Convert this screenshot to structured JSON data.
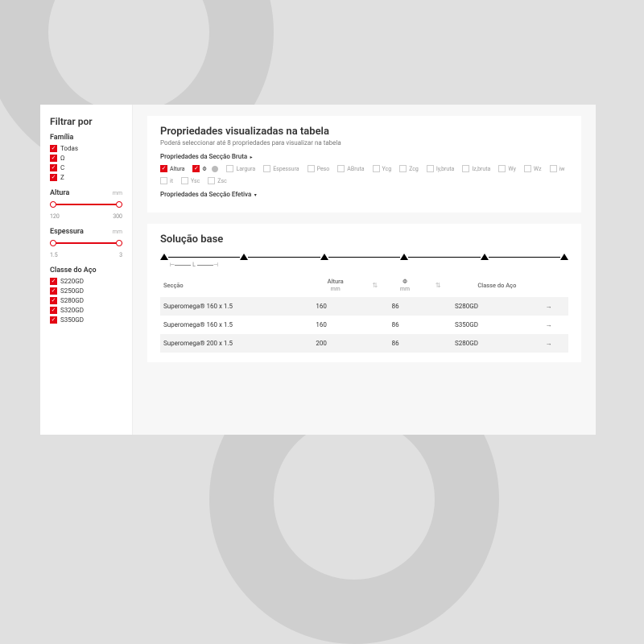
{
  "sidebar": {
    "title": "Filtrar por",
    "familia": {
      "title": "Família",
      "items": [
        {
          "label": "Todas",
          "checked": true
        },
        {
          "label": "Ω",
          "checked": true
        },
        {
          "label": "C",
          "checked": true
        },
        {
          "label": "Z",
          "checked": true
        }
      ]
    },
    "altura": {
      "title": "Altura",
      "unit": "mm",
      "min": "120",
      "max": "300"
    },
    "espessura": {
      "title": "Espessura",
      "unit": "mm",
      "min": "1.5",
      "max": "3"
    },
    "classe": {
      "title": "Classe do Aço",
      "items": [
        {
          "label": "S220GD",
          "checked": true
        },
        {
          "label": "S250GD",
          "checked": true
        },
        {
          "label": "S280GD",
          "checked": true
        },
        {
          "label": "S320GD",
          "checked": true
        },
        {
          "label": "S350GD",
          "checked": true
        }
      ]
    }
  },
  "propsCard": {
    "title": "Propriedades visualizadas na tabela",
    "subtitle": "Poderá seleccionar até 8 propriedades para visualizar na tabela",
    "sectBruta": "Propriedades da Secção Bruta",
    "sectEfetiva": "Propriedades da Secção Efetiva",
    "props": [
      {
        "label": "Altura",
        "checked": true
      },
      {
        "label": "Φ",
        "checked": true
      },
      {
        "label": "Largura",
        "checked": false
      },
      {
        "label": "Espessura",
        "checked": false
      },
      {
        "label": "Peso",
        "checked": false
      },
      {
        "label": "ABruta",
        "checked": false
      },
      {
        "label": "Ycg",
        "checked": false
      },
      {
        "label": "Zcg",
        "checked": false
      },
      {
        "label": "Iy,bruta",
        "checked": false
      },
      {
        "label": "Iz,bruta",
        "checked": false
      },
      {
        "label": "Wy",
        "checked": false
      },
      {
        "label": "Wz",
        "checked": false
      },
      {
        "label": "iw",
        "checked": false
      },
      {
        "label": "it",
        "checked": false
      },
      {
        "label": "Ysc",
        "checked": false
      },
      {
        "label": "Zsc",
        "checked": false
      }
    ]
  },
  "solutionCard": {
    "title": "Solução base",
    "lengthLabel": "L",
    "columns": {
      "seccao": "Secção",
      "altura": "Altura",
      "altura_unit": "mm",
      "phi": "Φ",
      "phi_unit": "mm",
      "classe": "Classe do Aço"
    },
    "rows": [
      {
        "seccao": "Superomega® 160 x 1.5",
        "altura": "160",
        "phi": "86",
        "classe": "S280GD"
      },
      {
        "seccao": "Superomega® 160 x 1.5",
        "altura": "160",
        "phi": "86",
        "classe": "S350GD"
      },
      {
        "seccao": "Superomega® 200 x 1.5",
        "altura": "200",
        "phi": "86",
        "classe": "S280GD"
      }
    ]
  }
}
